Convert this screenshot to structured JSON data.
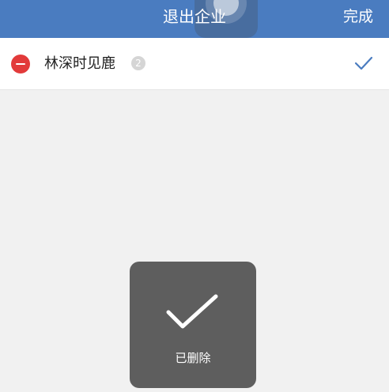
{
  "header": {
    "title": "退出企业",
    "done_label": "完成",
    "background_color": "#4a7cc0"
  },
  "member": {
    "name": "林深时见鹿",
    "badge": "2",
    "remove_icon": "minus-circle-icon",
    "remove_icon_color": "#e23a3a",
    "selected_icon": "checkmark-icon",
    "selected_icon_color": "#4a7cc0"
  },
  "toast": {
    "icon": "checkmark-icon",
    "message": "已删除",
    "background_color": "#5e5e5e"
  }
}
